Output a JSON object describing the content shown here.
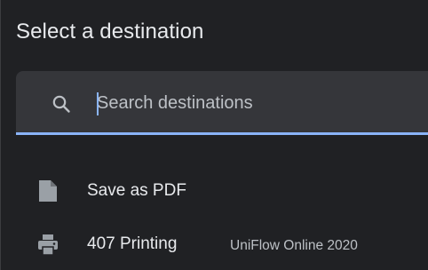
{
  "dialog": {
    "title": "Select a destination"
  },
  "search": {
    "placeholder": "Search destinations",
    "value": "",
    "icon": "search-icon"
  },
  "destinations": [
    {
      "name": "Save as PDF",
      "subtitle": "",
      "icon": "file-icon"
    },
    {
      "name": "407 Printing",
      "subtitle": "UniFlow Online 2020",
      "icon": "printer-icon"
    }
  ],
  "colors": {
    "background": "#202124",
    "search_field": "#35363a",
    "accent": "#8ab4f8",
    "text_primary": "#e8eaed",
    "text_secondary": "#bdc1c6",
    "icon": "#9aa0a6"
  }
}
